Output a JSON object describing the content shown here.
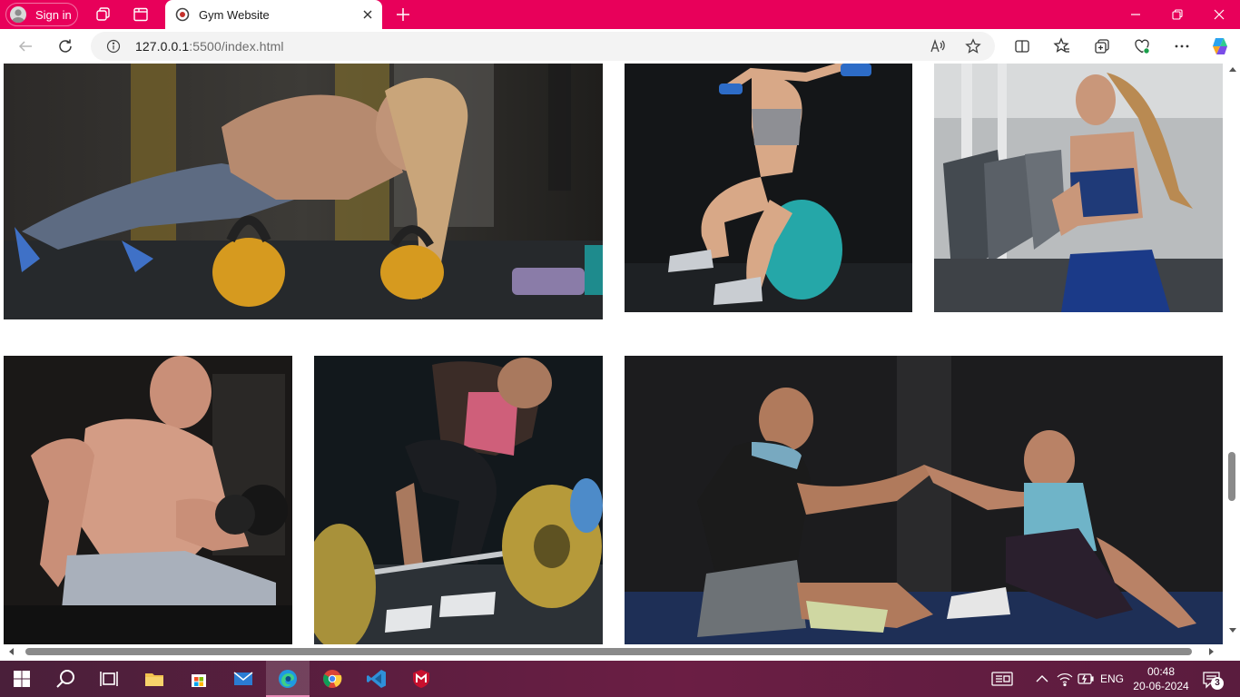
{
  "browser": {
    "profile": {
      "label": "Sign in"
    },
    "tab": {
      "title": "Gym Website"
    },
    "address": {
      "host": "127.0.0.1",
      "port_path": ":5500/index.html"
    },
    "accent_color": "#e8005a"
  },
  "gallery": {
    "images": [
      {
        "name": "pushup-kettlebell-photo",
        "description_icon": "photo"
      },
      {
        "name": "fitball-dumbbell-photo",
        "description_icon": "photo"
      },
      {
        "name": "treadmill-runner-photo",
        "description_icon": "photo"
      },
      {
        "name": "bodybuilder-curl-photo",
        "description_icon": "photo"
      },
      {
        "name": "deadlift-barbell-photo",
        "description_icon": "photo"
      },
      {
        "name": "high-five-partners-photo",
        "description_icon": "photo"
      }
    ]
  },
  "taskbar": {
    "language": "ENG",
    "time": "00:48",
    "date": "20-06-2024",
    "notification_count": "3"
  }
}
